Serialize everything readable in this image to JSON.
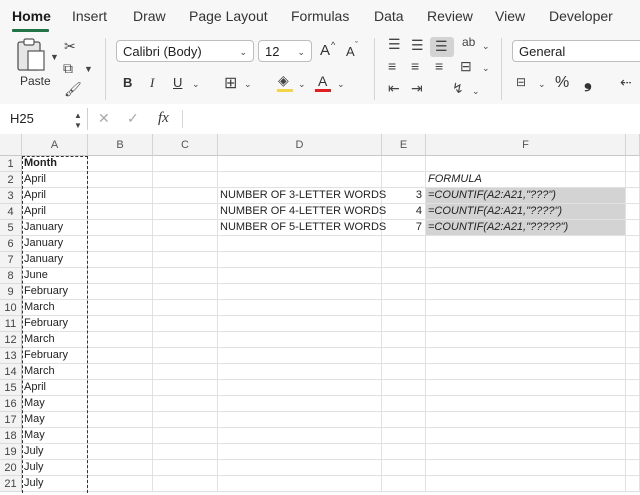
{
  "tabs": [
    "Home",
    "Insert",
    "Draw",
    "Page Layout",
    "Formulas",
    "Data",
    "Review",
    "View",
    "Developer"
  ],
  "ribbon": {
    "paste_label": "Paste",
    "font_name": "Calibri (Body)",
    "font_size": "12",
    "grow_font": "A",
    "shrink_font": "A",
    "bold": "B",
    "italic": "I",
    "underline": "U",
    "number_format": "General",
    "percent": "%",
    "comma": "❟",
    "colors": {
      "fill_accent": "#f2d54d",
      "font_accent": "#e02020"
    }
  },
  "formula_bar": {
    "name_box": "H25",
    "fx": "fx",
    "value": ""
  },
  "columns": [
    "A",
    "B",
    "C",
    "D",
    "E",
    "F"
  ],
  "rows": [
    "1",
    "2",
    "3",
    "4",
    "5",
    "6",
    "7",
    "8",
    "9",
    "10",
    "11",
    "12",
    "13",
    "14",
    "15",
    "16",
    "17",
    "18",
    "19",
    "20",
    "21"
  ],
  "column_a": [
    "Month",
    "April",
    "April",
    "April",
    "January",
    "January",
    "January",
    "June",
    "February",
    "March",
    "February",
    "March",
    "February",
    "March",
    "April",
    "May",
    "May",
    "May",
    "July",
    "July",
    "July"
  ],
  "summary": {
    "formula_header": "FORMULA",
    "rows": [
      {
        "label": "NUMBER OF 3-LETTER WORDS",
        "value": "3",
        "formula": "=COUNTIF(A2:A21,\"???\")"
      },
      {
        "label": "NUMBER OF 4-LETTER WORDS",
        "value": "4",
        "formula": "=COUNTIF(A2:A21,\"????\")"
      },
      {
        "label": "NUMBER OF 5-LETTER WORDS",
        "value": "7",
        "formula": "=COUNTIF(A2:A21,\"?????\")"
      }
    ]
  }
}
